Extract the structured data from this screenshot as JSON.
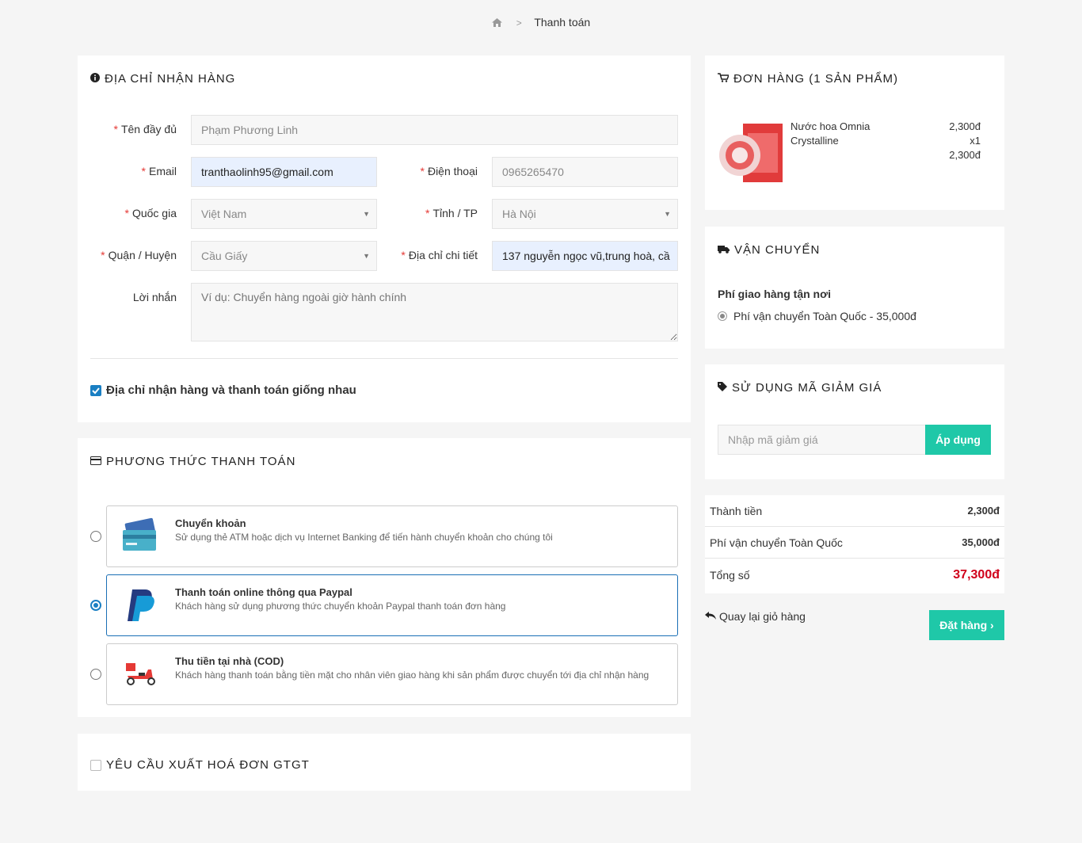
{
  "breadcrumb": {
    "current": "Thanh toán"
  },
  "address": {
    "title": "ĐỊA CHỈ NHẬN HÀNG",
    "fullname_label": "Tên đầy đủ",
    "fullname_value": "Phạm Phương Linh",
    "email_label": "Email",
    "email_value": "tranthaolinh95@gmail.com",
    "phone_label": "Điện thoại",
    "phone_value": "0965265470",
    "country_label": "Quốc gia",
    "country_value": "Việt Nam",
    "province_label": "Tỉnh / TP",
    "province_value": "Hà Nội",
    "district_label": "Quận / Huyện",
    "district_value": "Cầu Giấy",
    "detail_label": "Địa chỉ chi tiết",
    "detail_value": "137 nguyễn ngọc vũ,trung hoà, cầ",
    "note_label": "Lời nhắn",
    "note_placeholder": "Ví dụ: Chuyển hàng ngoài giờ hành chính",
    "same_address_label": "Địa chỉ nhận hàng và thanh toán giống nhau"
  },
  "payment": {
    "title": "PHƯƠNG THỨC THANH TOÁN",
    "options": [
      {
        "title": "Chuyển khoản",
        "desc": "Sử dụng thẻ ATM hoặc dịch vụ Internet Banking để tiến hành chuyển khoản cho chúng tôi"
      },
      {
        "title": "Thanh toán online thông qua Paypal",
        "desc": "Khách hàng sử dụng phương thức chuyển khoản Paypal thanh toán đơn hàng"
      },
      {
        "title": "Thu tiền tại nhà (COD)",
        "desc": "Khách hàng thanh toán bằng tiền mặt cho nhân viên giao hàng khi sản phẩm được chuyển tới địa chỉ nhận hàng"
      }
    ],
    "selected_index": 1
  },
  "vat": {
    "title": "YÊU CẦU XUẤT HOÁ ĐƠN GTGT"
  },
  "order": {
    "title": "ĐƠN HÀNG (1 SẢN PHẨM)",
    "item_name_line1": "Nước hoa Omnia",
    "item_name_line2": "Crystalline",
    "item_price": "2,300đ",
    "item_qty": "x1",
    "item_total": "2,300đ"
  },
  "shipping": {
    "title": "VẬN CHUYỂN",
    "subtitle": "Phí giao hàng tận nơi",
    "option": "Phí vận chuyển Toàn Quốc - 35,000đ"
  },
  "coupon": {
    "title": "SỬ DỤNG MÃ GIẢM GIÁ",
    "placeholder": "Nhập mã giảm giá",
    "apply_label": "Áp dụng"
  },
  "summary": {
    "subtotal_label": "Thành tiền",
    "subtotal_value": "2,300đ",
    "shipping_label": "Phí vận chuyển Toàn Quốc",
    "shipping_value": "35,000đ",
    "total_label": "Tổng số",
    "total_value": "37,300đ",
    "back_label": "Quay lại giỏ hàng",
    "order_label": "Đặt hàng"
  },
  "colors": {
    "accent": "#1fc8a8",
    "total": "#d0021b",
    "selected_border": "#1a6fb5"
  }
}
